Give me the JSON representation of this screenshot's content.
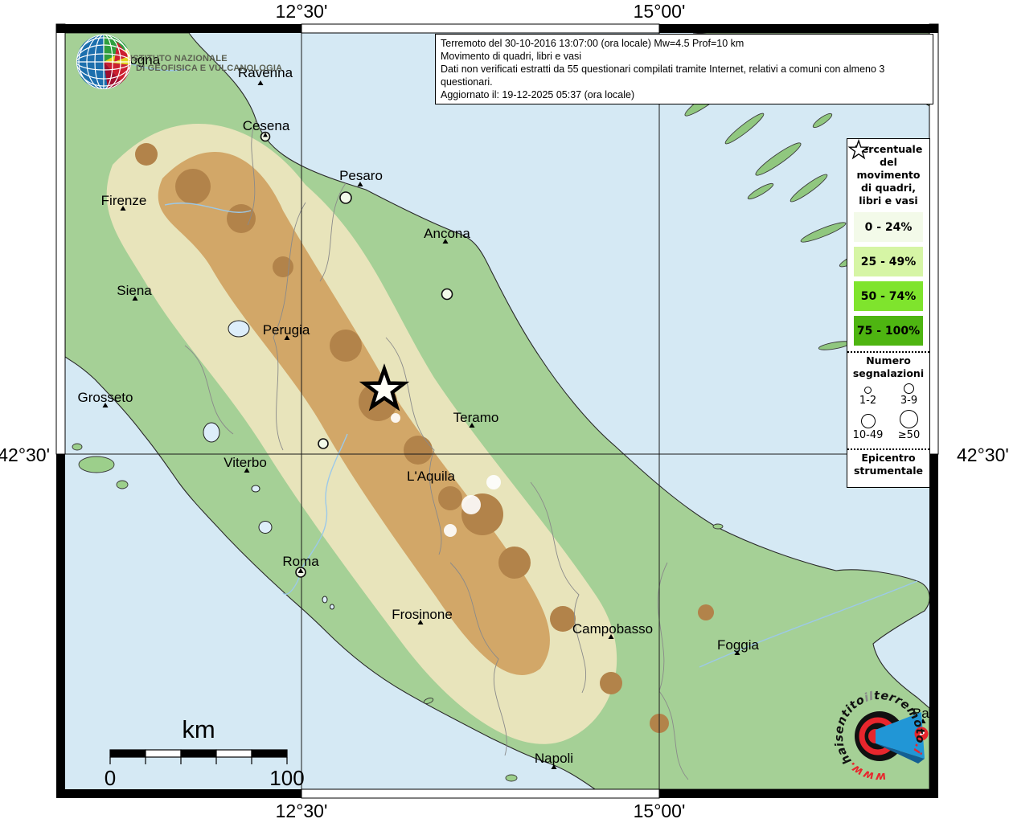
{
  "title_box": {
    "lines": [
      "Terremoto del 30-10-2016 13:07:00 (ora locale) Mw=4.5 Prof=10 km",
      "Movimento di quadri, libri e vasi",
      "Dati non verificati estratti da 55 questionari compilati tramite Internet, relativi a comuni con almeno 3 questionari.",
      "Aggiornato il: 19-12-2025 05:37 (ora locale)"
    ]
  },
  "coordinates": {
    "top_left": "12°30'",
    "top_right": "15°00'",
    "bottom_left": "12°30'",
    "bottom_right": "15°00'",
    "left": "42°30'",
    "right": "42°30'"
  },
  "legend": {
    "title": "Percentuale\ndel\nmovimento\ndi quadri,\nlibri e vasi",
    "classes": [
      {
        "label": "0 - 24%",
        "color": "#f3fae9"
      },
      {
        "label": "25 - 49%",
        "color": "#d6f5a5"
      },
      {
        "label": "50 - 74%",
        "color": "#7fe42d"
      },
      {
        "label": "75 - 100%",
        "color": "#4eb511"
      }
    ],
    "reports_title": "Numero\nsegnalazioni",
    "report_sizes": [
      "1-2",
      "3-9",
      "10-49",
      "≥50"
    ],
    "epicenter_title": "Epicentro\nstrumentale"
  },
  "scale_bar": {
    "unit": "km",
    "start": "0",
    "end": "100"
  },
  "ingv_logo": {
    "line1": "ISTITUTO NAZIONALE",
    "line2": "DI GEOFISICA E VULCANOLOGIA"
  },
  "hst_logo": {
    "www": "www.",
    "hai": "hai",
    "sentito": "sentito",
    "il": "il",
    "terremoto": "terremoto",
    "it": ".it",
    "question": "?"
  },
  "map": {
    "cities": [
      {
        "name": "Bologna"
      },
      {
        "name": "Ravenna"
      },
      {
        "name": "Cesena"
      },
      {
        "name": "Pesaro"
      },
      {
        "name": "Ancona"
      },
      {
        "name": "Firenze"
      },
      {
        "name": "Siena"
      },
      {
        "name": "Perugia"
      },
      {
        "name": "Grosseto"
      },
      {
        "name": "Teramo"
      },
      {
        "name": "Viterbo"
      },
      {
        "name": "L'Aquila"
      },
      {
        "name": "Roma"
      },
      {
        "name": "Frosinone"
      },
      {
        "name": "Campobasso"
      },
      {
        "name": "Foggia"
      },
      {
        "name": "Napoli"
      },
      {
        "name": "Bari"
      }
    ],
    "epicenter_symbol": "star",
    "report_circles_class": "0 - 24%",
    "report_circles_count": 5
  }
}
